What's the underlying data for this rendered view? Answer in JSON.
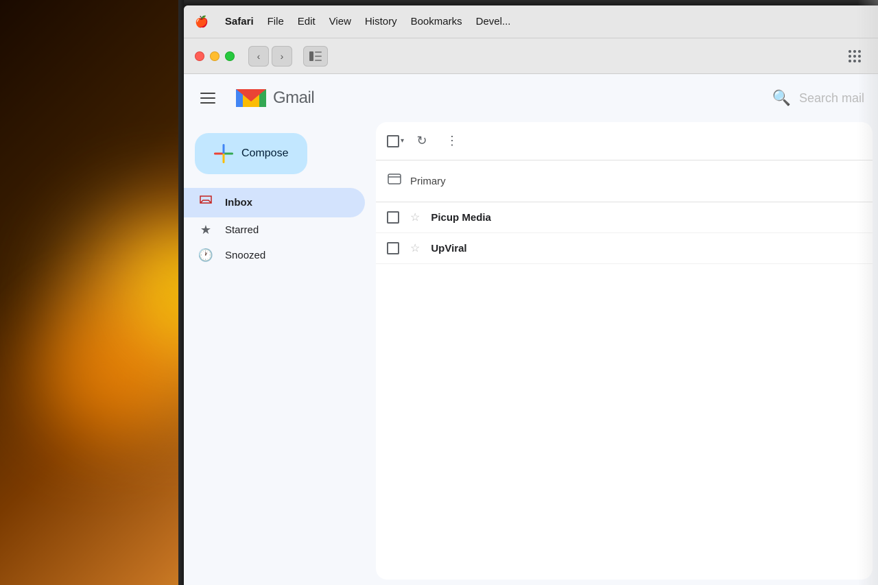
{
  "background": {
    "description": "warm bokeh background with laptop"
  },
  "menubar": {
    "apple": "🍎",
    "safari": "Safari",
    "file": "File",
    "edit": "Edit",
    "view": "View",
    "history": "History",
    "bookmarks": "Bookmarks",
    "develop": "Devel..."
  },
  "browser": {
    "back_label": "‹",
    "forward_label": "›",
    "sidebar_icon": "sidebar",
    "grid_label": "⠿"
  },
  "gmail": {
    "header": {
      "menu_label": "menu",
      "logo_text": "Gmail",
      "search_placeholder": "Search mail"
    },
    "compose": {
      "label": "Compose",
      "icon": "+"
    },
    "nav": {
      "inbox_label": "Inbox",
      "starred_label": "Starred",
      "snoozed_label": "Snoozed"
    },
    "toolbar": {
      "select_all": "select all",
      "refresh": "↻",
      "more": "⋮"
    },
    "tabs": {
      "primary_label": "Primary"
    },
    "emails": [
      {
        "sender": "Picup Media",
        "starred": false
      },
      {
        "sender": "UpViral",
        "starred": false
      }
    ]
  }
}
